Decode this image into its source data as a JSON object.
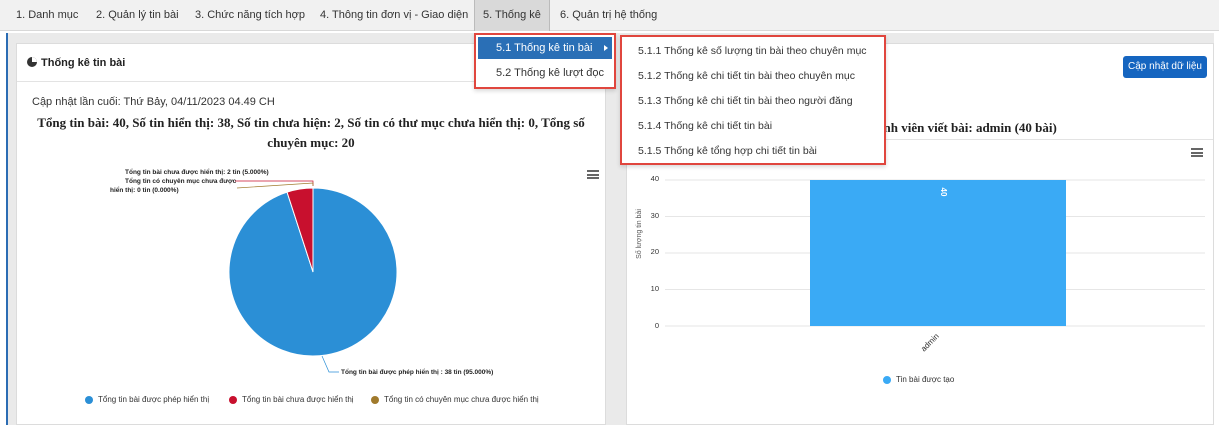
{
  "menu": [
    "1. Danh mục",
    "2. Quản lý tin bài",
    "3. Chức năng tích hợp",
    "4. Thông tin đơn vị - Giao diện",
    "5. Thống kê",
    "6. Quản trị hệ thống"
  ],
  "dropdown": {
    "items": [
      "5.1 Thống kê tin bài",
      "5.2 Thống kê lượt đọc"
    ],
    "submenu": [
      "5.1.1 Thống kê số lượng tin bài theo chuyên mục",
      "5.1.2 Thống kê chi tiết tin bài theo chuyên mục",
      "5.1.3 Thống kê chi tiết tin bài theo người đăng",
      "5.1.4 Thống kê chi tiết tin bài",
      "5.1.5 Thống kê tổng hợp chi tiết tin bài"
    ]
  },
  "left": {
    "title": "Thống kê tin bài",
    "last_update": "Cập nhật lần cuối: Thứ Bảy, 04/11/2023 04.49 CH",
    "summary_line1": "Tổng tin bài: 40, Số tin hiển thị: 38, Số tin chưa hiện: 2, Số tin có thư mục chưa hiển thị: 0, Tổng số",
    "summary_line2": "chuyên mục: 20"
  },
  "right": {
    "update_button": "Cập nhật dữ liệu",
    "chart_title_partial": "ành viên viết bài: admin (40 bài)"
  },
  "chart_data": [
    {
      "type": "pie",
      "slices": [
        {
          "name": "Tổng tin bài được phép hiển thị",
          "value": 38,
          "percent": 95.0,
          "color": "#2b8fd6"
        },
        {
          "name": "Tổng tin bài chưa được hiển thị",
          "value": 2,
          "percent": 5.0,
          "color": "#c8102e"
        },
        {
          "name": "Tổng tin có chuyên mục chưa được hiển thị",
          "value": 0,
          "percent": 0.0,
          "color": "#a07a2c"
        }
      ],
      "data_labels": [
        "Tổng tin bài chưa được hiển thị: 2 tin (5.000%)",
        "Tổng tin có chuyên mục chưa được",
        "hiển thị: 0 tin (0.000%)",
        "Tổng tin bài được phép hiển thị : 38 tin (95.000%)"
      ],
      "legend": [
        "Tổng tin bài được phép hiển thị",
        "Tổng tin bài chưa được hiển thị",
        "Tổng tin có chuyên mục chưa được hiển thị"
      ]
    },
    {
      "type": "bar",
      "categories": [
        "admin"
      ],
      "series": [
        {
          "name": "Tin bài được tạo",
          "values": [
            40
          ],
          "color": "#3aaaf5"
        }
      ],
      "ylabel": "Số lượng tin bài",
      "ylim": [
        0,
        40
      ],
      "yticks": [
        "0",
        "10",
        "20",
        "30",
        "40"
      ],
      "data_label": "40"
    }
  ]
}
